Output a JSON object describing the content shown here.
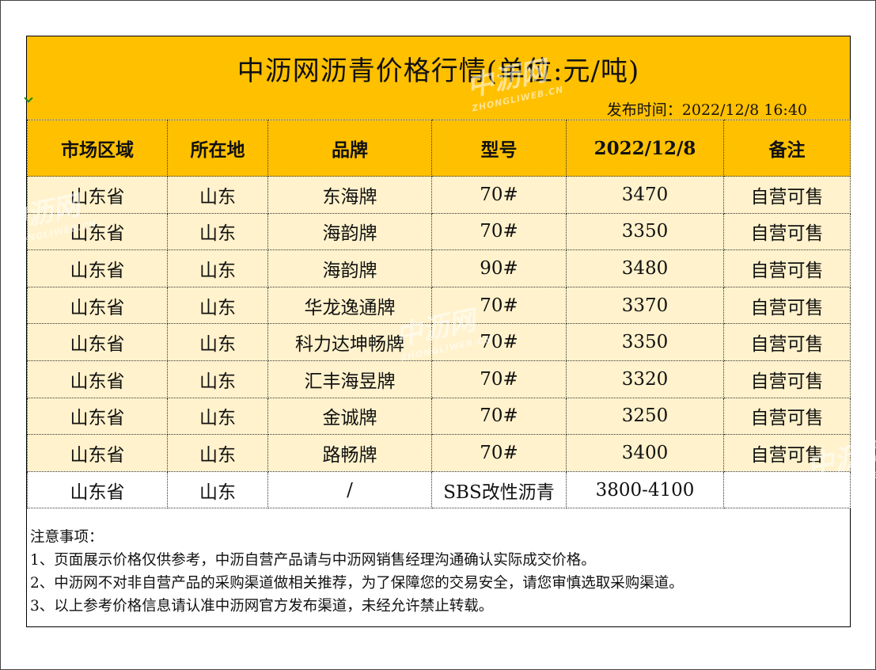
{
  "title": "中沥网沥青价格行情(单位:元/吨)",
  "publish_time": "发布时间：2022/12/8 16:40",
  "table": {
    "headers": [
      "市场区域",
      "所在地",
      "品牌",
      "型号",
      "2022/12/8",
      "备注"
    ],
    "rows": [
      {
        "region": "山东省",
        "location": "山东",
        "brand": "东海牌",
        "model": "70#",
        "price": "3470",
        "note": "自营可售"
      },
      {
        "region": "山东省",
        "location": "山东",
        "brand": "海韵牌",
        "model": "70#",
        "price": "3350",
        "note": "自营可售"
      },
      {
        "region": "山东省",
        "location": "山东",
        "brand": "海韵牌",
        "model": "90#",
        "price": "3480",
        "note": "自营可售"
      },
      {
        "region": "山东省",
        "location": "山东",
        "brand": "华龙逸通牌",
        "model": "70#",
        "price": "3370",
        "note": "自营可售"
      },
      {
        "region": "山东省",
        "location": "山东",
        "brand": "科力达坤畅牌",
        "model": "70#",
        "price": "3350",
        "note": "自营可售"
      },
      {
        "region": "山东省",
        "location": "山东",
        "brand": "汇丰海昱牌",
        "model": "70#",
        "price": "3320",
        "note": "自营可售"
      },
      {
        "region": "山东省",
        "location": "山东",
        "brand": "金诚牌",
        "model": "70#",
        "price": "3250",
        "note": "自营可售"
      },
      {
        "region": "山东省",
        "location": "山东",
        "brand": "路畅牌",
        "model": "70#",
        "price": "3400",
        "note": "自营可售"
      },
      {
        "region": "山东省",
        "location": "山东",
        "brand": "/",
        "model": "SBS改性沥青",
        "price": "3800-4100",
        "note": ""
      }
    ]
  },
  "notes": {
    "heading": "注意事项：",
    "items": [
      "1、页面展示价格仅供参考，中沥自营产品请与中沥网销售经理沟通确认实际成交价格。",
      "2、中沥网不对非自营产品的采购渠道做相关推荐，为了保障您的交易安全，请您审慎选取采购渠道。",
      "3、以上参考价格信息请认准中沥网官方发布渠道，未经允许禁止转载。"
    ]
  },
  "watermark": {
    "logo": "中沥网",
    "site": "ZHONGLIWEB.CN"
  },
  "colors": {
    "header_fill": "#FFC000",
    "row_fill": "#FFF2CC"
  }
}
